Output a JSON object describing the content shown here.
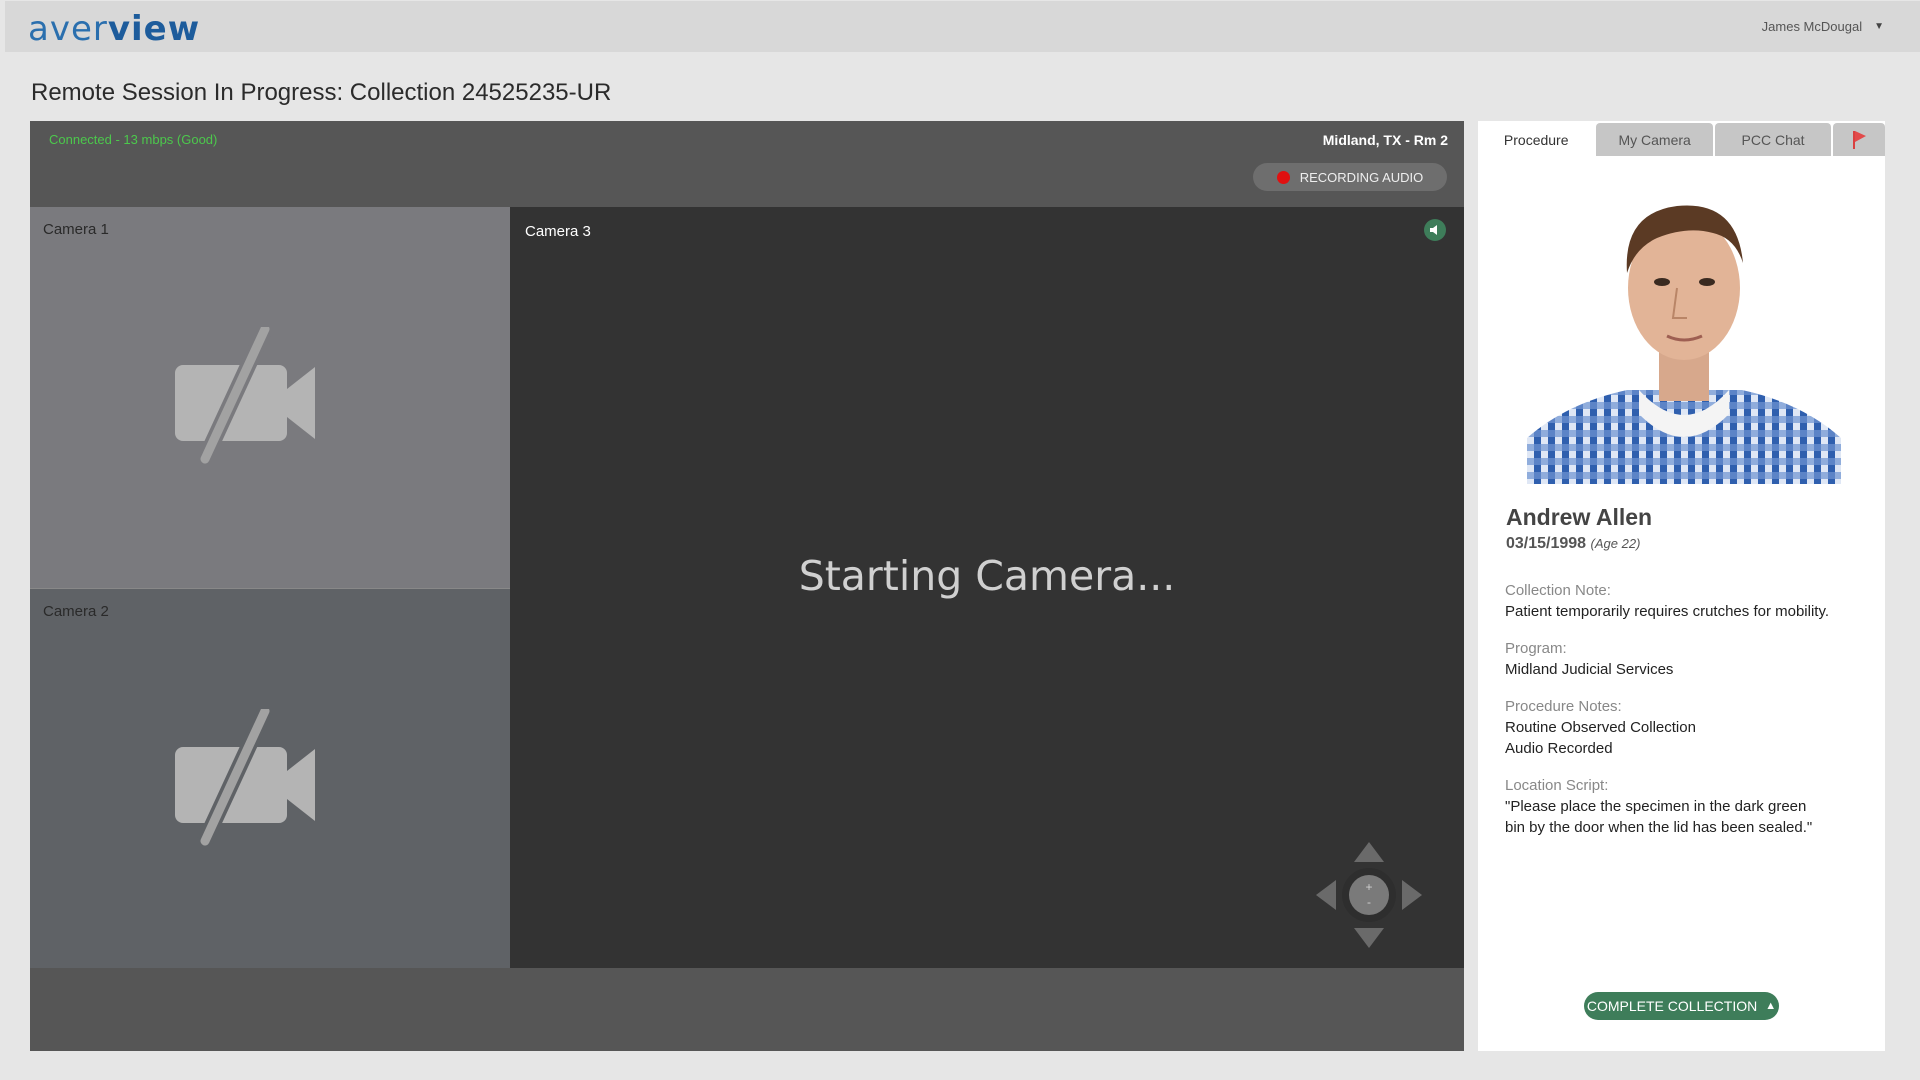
{
  "app": {
    "logo_light": "aver",
    "logo_bold": "view",
    "user_name": "James McDougal"
  },
  "page": {
    "title": "Remote Session In Progress: Collection 24525235-UR"
  },
  "session": {
    "connection": "Connected - 13 mbps  (Good)",
    "location": "Midland, TX - Rm 2",
    "recording_label": "RECORDING AUDIO",
    "cameras": [
      {
        "label": "Camera 1"
      },
      {
        "label": "Camera 2"
      },
      {
        "label": "Camera 3",
        "status": "Starting Camera..."
      }
    ]
  },
  "side": {
    "tabs": [
      {
        "label": "Procedure",
        "active": true
      },
      {
        "label": "My Camera",
        "active": false
      },
      {
        "label": "PCC Chat",
        "active": false
      }
    ],
    "patient": {
      "name": "Andrew Allen",
      "dob": "03/15/1998",
      "age": "(Age 22)"
    },
    "fields": [
      {
        "label": "Collection Note:",
        "lines": [
          "Patient temporarily requires crutches for mobility."
        ]
      },
      {
        "label": "Program:",
        "lines": [
          "Midland Judicial Services"
        ]
      },
      {
        "label": "Procedure Notes:",
        "lines": [
          "Routine Observed Collection",
          "Audio Recorded"
        ]
      },
      {
        "label": "Location Script:",
        "lines": [
          "\"Please place the specimen in the dark green",
          "bin by the door when the lid has been sealed.\""
        ]
      }
    ],
    "complete_label": "COMPLETE COLLECTION"
  },
  "colors": {
    "accent_green": "#3e7d5a",
    "connection_green": "#4cc84c",
    "record_red": "#e01010",
    "brand_blue": "#1d5c9c"
  }
}
